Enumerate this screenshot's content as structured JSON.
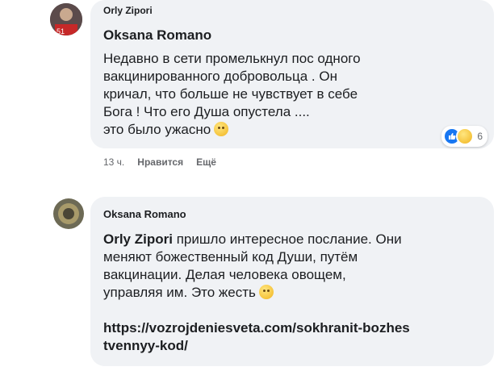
{
  "comment1": {
    "avatar_text": "51",
    "reply_to": "Orly Zipori",
    "author": "Oksana Romano",
    "lines": [
      "Недавно в сети промелькнул пос одного",
      "вакцинированного добровольца . Он",
      "кричал, что больше не чувствует в себе",
      "Бога ! Что его Душа опустела ....",
      "это было ужасно"
    ],
    "reactions": {
      "count": "6",
      "types": [
        "like-icon",
        "sad-icon"
      ]
    },
    "time": "13 ч.",
    "like_label": "Нравится",
    "more_label": "Ещё"
  },
  "comment2": {
    "author": "Oksana Romano",
    "mention": "Orly Zipori",
    "lines": [
      "пришло интересное послание. Они",
      "меняют божественный код Души, путём",
      "вакцинации. Делая человека овощем,",
      "управляя им. Это жесть"
    ],
    "link_lines": [
      "https://vozrojdeniesveta.com/sokhranit-bozhes",
      "tvennyy-kod/"
    ]
  },
  "colors": {
    "bubble": "#f0f2f5",
    "text": "#1c1e21",
    "meta": "#65676b",
    "like": "#1877f2"
  }
}
